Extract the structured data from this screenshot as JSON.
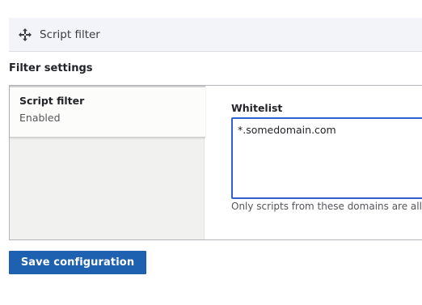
{
  "filter_row": {
    "handle_icon": "move-arrows-icon",
    "label": "Script filter"
  },
  "section_title": "Filter settings",
  "vertical_tabs": {
    "items": [
      {
        "title": "Script filter",
        "summary": "Enabled"
      }
    ]
  },
  "whitelist": {
    "label": "Whitelist",
    "value": "*.somedomain.com",
    "description": "Only scripts from these domains are allowed."
  },
  "save_button": {
    "label": "Save configuration"
  },
  "colors": {
    "button_bg": "#1f61b1",
    "input_focus_border": "#2f5fd0",
    "row_bg": "#f3f4f9",
    "tabs_menu_bg": "#f1f1f0"
  }
}
